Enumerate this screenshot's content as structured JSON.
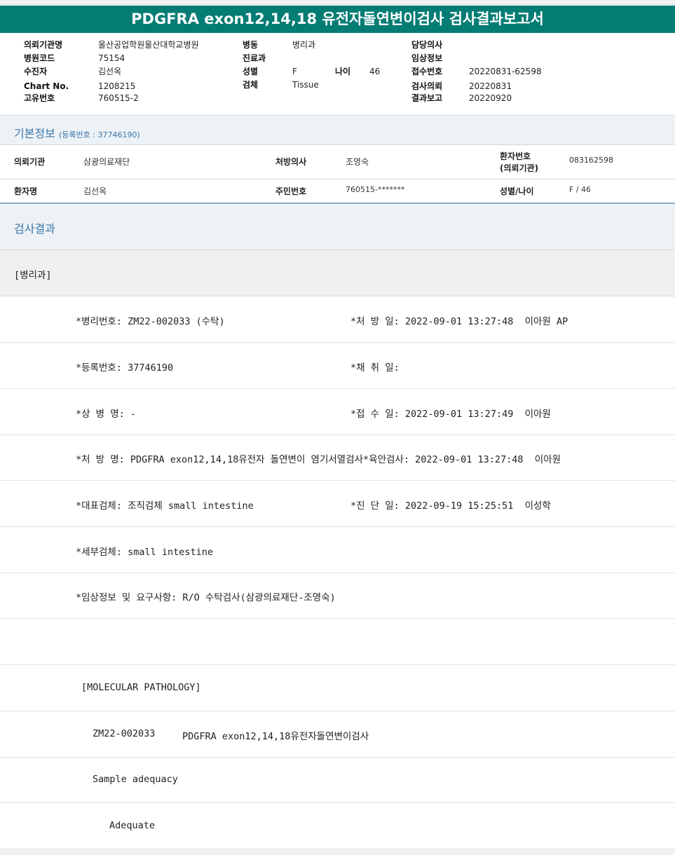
{
  "report": {
    "title": "PDGFRA exon12,14,18 유전자돌연변이검사 검사결과보고서"
  },
  "header": {
    "institution_label": "의뢰기관명",
    "institution_value": "울산공업학원울산대학교병원",
    "hospital_code_label": "병원코드",
    "hospital_code_value": "75154",
    "recipient_label": "수진자",
    "recipient_value": "김선옥",
    "chart_label": "Chart No.",
    "chart_value": "1208215",
    "unique_label": "고유번호",
    "unique_value": "760515-2",
    "ward_label": "병동",
    "ward_value": "병리과",
    "dept_label": "진료과",
    "dept_value": "",
    "sex_label": "성별",
    "sex_value": "F",
    "age_label": "나이",
    "age_value": "46",
    "specimen_label": "검체",
    "specimen_value": "Tissue",
    "doctor_label": "담당의사",
    "doctor_value": "",
    "clinical_label": "임상정보",
    "clinical_value": "",
    "receipt_label": "접수번호",
    "receipt_value": "20220831-62598",
    "request_label": "검사의뢰",
    "request_value": "20220831",
    "report_label": "결과보고",
    "report_value": "20220920"
  },
  "basic": {
    "title": "기본정보",
    "subtitle": "(등록번호 : 37746190)",
    "row1": {
      "inst_label": "의뢰기관",
      "inst_value": "삼광의료재단",
      "doc_label": "처방의사",
      "doc_value": "조영숙",
      "pno_label_1": "환자번호",
      "pno_label_2": "(의뢰기관)",
      "pno_value": "083162598"
    },
    "row2": {
      "name_label": "환자명",
      "name_value": "김선옥",
      "rrn_label": "주민번호",
      "rrn_value": "760515-*******",
      "sexage_label": "성별/나이",
      "sexage_value": "F / 46"
    }
  },
  "results": {
    "title": "검사결과",
    "dept": "[병리과]",
    "lines": [
      {
        "left": "*병리번호: ZM22-002033 (수탁)",
        "right": "*처 방 일: 2022-09-01 13:27:48  이아원 AP"
      },
      {
        "left": "*등록번호: 37746190",
        "right": "*채 취 일:"
      },
      {
        "left": "*상 병 명: -",
        "right": "*접 수 일: 2022-09-01 13:27:49  이아원"
      },
      {
        "left": "*처 방 명: PDGFRA exon12,14,18유전자 돌연변이 염기서열검사*육안검사: 2022-09-01 13:27:48  이아원",
        "right": ""
      },
      {
        "left": "*대표검체: 조직검체 small intestine",
        "right": "*진 단 일: 2022-09-19 15:25:51  이성학"
      },
      {
        "left": "*세부검체: small intestine",
        "right": ""
      },
      {
        "left": "*임상정보 및 요구사항: R/O 수탁검사(삼광의료재단-조영숙)",
        "right": ""
      },
      {
        "left": "",
        "right": ""
      }
    ],
    "mol_title": "[MOLECULAR PATHOLOGY]",
    "mol_id": "ZM22-002033",
    "mol_test": "PDGFRA exon12,14,18유전자돌연변이검사",
    "adequacy_label": "Sample adequacy",
    "adequacy_value": "Adequate"
  }
}
